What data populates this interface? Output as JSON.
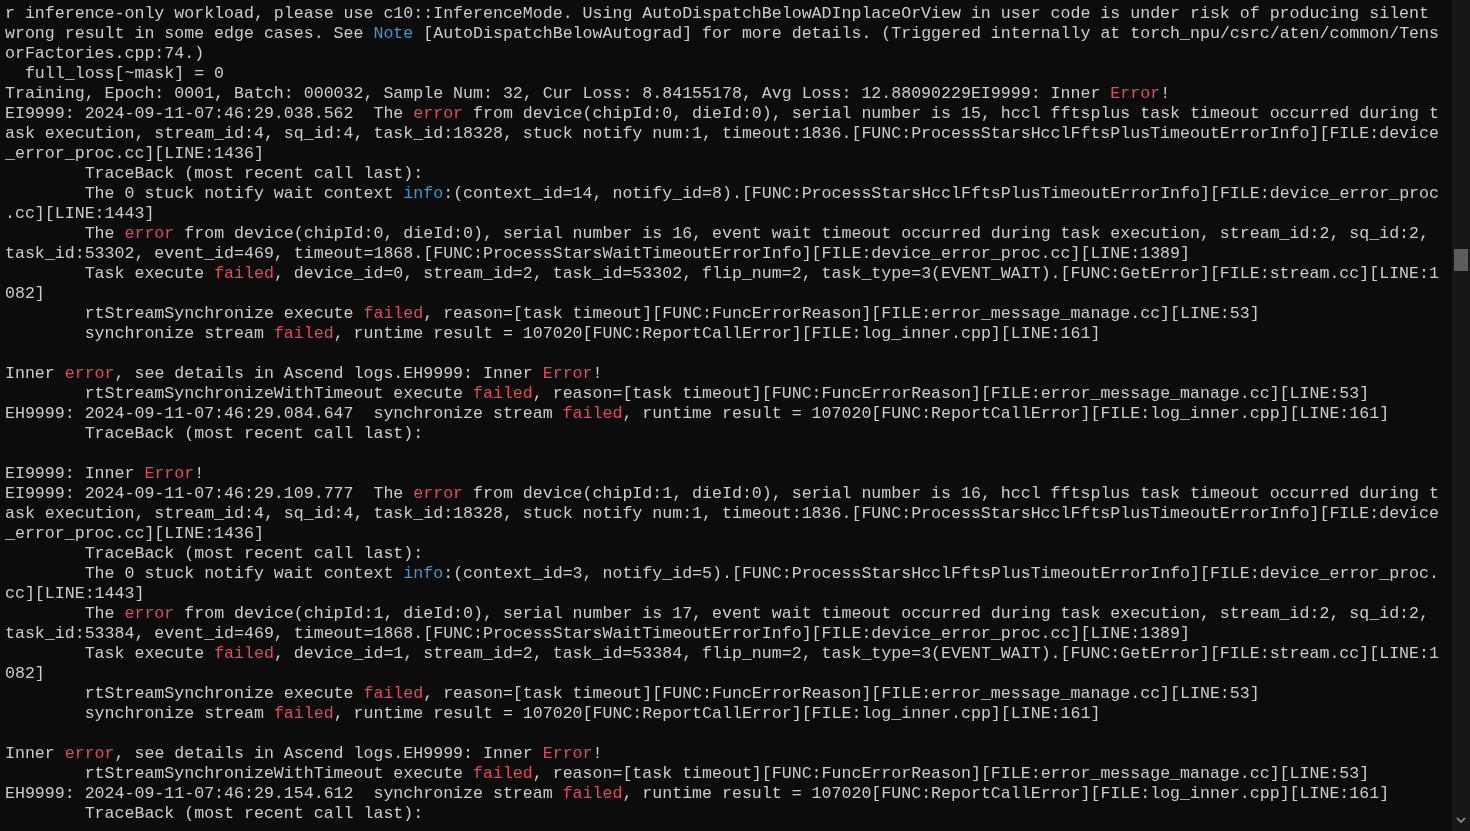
{
  "terminal": {
    "lines": [
      {
        "kind": "text",
        "segments": [
          {
            "text": "r inference-only workload, please use c10::InferenceMode. Using AutoDispatchBelowADInplaceOrView in user code is under risk of producing silent",
            "kind": "plain"
          }
        ]
      },
      {
        "kind": "text",
        "segments": [
          {
            "text": "wrong result in some edge cases. See ",
            "kind": "plain"
          },
          {
            "text": "Note",
            "kind": "info"
          },
          {
            "text": " [AutoDispatchBelowAutograd] for more details. (Triggered internally at torch_npu/csrc/aten/common/Tens",
            "kind": "plain"
          }
        ]
      },
      {
        "kind": "text",
        "segments": [
          {
            "text": "orFactories.cpp:74.)",
            "kind": "plain"
          }
        ]
      },
      {
        "kind": "text",
        "segments": [
          {
            "text": "  full_loss[~mask] = 0",
            "kind": "plain"
          }
        ]
      },
      {
        "kind": "text",
        "segments": [
          {
            "text": "Training, Epoch: 0001, Batch: 000032, Sample Num: 32, Cur Loss: 8.84155178, Avg Loss: 12.88090229EI9999: Inner ",
            "kind": "plain"
          },
          {
            "text": "Error",
            "kind": "error"
          },
          {
            "text": "!",
            "kind": "plain"
          }
        ]
      },
      {
        "kind": "text",
        "segments": [
          {
            "text": "EI9999: 2024-09-11-07:46:29.038.562  The ",
            "kind": "plain"
          },
          {
            "text": "error",
            "kind": "error"
          },
          {
            "text": " from device(chipId:0, dieId:0), serial number is 15, hccl fftsplus task timeout occurred during t",
            "kind": "plain"
          }
        ]
      },
      {
        "kind": "text",
        "segments": [
          {
            "text": "ask execution, stream_id:4, sq_id:4, task_id:18328, stuck notify num:1, timeout:1836.[FUNC:ProcessStarsHcclFftsPlusTimeoutErrorInfo][FILE:device",
            "kind": "plain"
          }
        ]
      },
      {
        "kind": "text",
        "segments": [
          {
            "text": "_error_proc.cc][LINE:1436]",
            "kind": "plain"
          }
        ]
      },
      {
        "kind": "text",
        "segments": [
          {
            "text": "        TraceBack (most recent call last):",
            "kind": "plain"
          }
        ]
      },
      {
        "kind": "text",
        "segments": [
          {
            "text": "        The 0 stuck notify wait context ",
            "kind": "plain"
          },
          {
            "text": "info",
            "kind": "info"
          },
          {
            "text": ":(context_id=14, notify_id=8).[FUNC:ProcessStarsHcclFftsPlusTimeoutErrorInfo][FILE:device_error_proc",
            "kind": "plain"
          }
        ]
      },
      {
        "kind": "text",
        "segments": [
          {
            "text": ".cc][LINE:1443]",
            "kind": "plain"
          }
        ]
      },
      {
        "kind": "text",
        "segments": [
          {
            "text": "        The ",
            "kind": "plain"
          },
          {
            "text": "error",
            "kind": "error"
          },
          {
            "text": " from device(chipId:0, dieId:0), serial number is 16, event wait timeout occurred during task execution, stream_id:2, sq_id:2,",
            "kind": "plain"
          }
        ]
      },
      {
        "kind": "text",
        "segments": [
          {
            "text": "task_id:53302, event_id=469, timeout=1868.[FUNC:ProcessStarsWaitTimeoutErrorInfo][FILE:device_error_proc.cc][LINE:1389]",
            "kind": "plain"
          }
        ]
      },
      {
        "kind": "text",
        "segments": [
          {
            "text": "        Task execute ",
            "kind": "plain"
          },
          {
            "text": "failed",
            "kind": "error"
          },
          {
            "text": ", device_id=0, stream_id=2, task_id=53302, flip_num=2, task_type=3(EVENT_WAIT).[FUNC:GetError][FILE:stream.cc][LINE:1",
            "kind": "plain"
          }
        ]
      },
      {
        "kind": "text",
        "segments": [
          {
            "text": "082]",
            "kind": "plain"
          }
        ]
      },
      {
        "kind": "text",
        "segments": [
          {
            "text": "        rtStreamSynchronize execute ",
            "kind": "plain"
          },
          {
            "text": "failed",
            "kind": "error"
          },
          {
            "text": ", reason=[task timeout][FUNC:FuncErrorReason][FILE:error_message_manage.cc][LINE:53]",
            "kind": "plain"
          }
        ]
      },
      {
        "kind": "text",
        "segments": [
          {
            "text": "        synchronize stream ",
            "kind": "plain"
          },
          {
            "text": "failed",
            "kind": "error"
          },
          {
            "text": ", runtime result = 107020[FUNC:ReportCallError][FILE:log_inner.cpp][LINE:161]",
            "kind": "plain"
          }
        ]
      },
      {
        "kind": "blank"
      },
      {
        "kind": "text",
        "segments": [
          {
            "text": "Inner ",
            "kind": "plain"
          },
          {
            "text": "error",
            "kind": "error"
          },
          {
            "text": ", see details in Ascend logs.EH9999: Inner ",
            "kind": "plain"
          },
          {
            "text": "Error",
            "kind": "error"
          },
          {
            "text": "!",
            "kind": "plain"
          }
        ]
      },
      {
        "kind": "text",
        "segments": [
          {
            "text": "        rtStreamSynchronizeWithTimeout execute ",
            "kind": "plain"
          },
          {
            "text": "failed",
            "kind": "error"
          },
          {
            "text": ", reason=[task timeout][FUNC:FuncErrorReason][FILE:error_message_manage.cc][LINE:53]",
            "kind": "plain"
          }
        ]
      },
      {
        "kind": "text",
        "segments": [
          {
            "text": "EH9999: 2024-09-11-07:46:29.084.647  synchronize stream ",
            "kind": "plain"
          },
          {
            "text": "failed",
            "kind": "error"
          },
          {
            "text": ", runtime result = 107020[FUNC:ReportCallError][FILE:log_inner.cpp][LINE:161]",
            "kind": "plain"
          }
        ]
      },
      {
        "kind": "text",
        "segments": [
          {
            "text": "        TraceBack (most recent call last):",
            "kind": "plain"
          }
        ]
      },
      {
        "kind": "blank"
      },
      {
        "kind": "text",
        "segments": [
          {
            "text": "EI9999: Inner ",
            "kind": "plain"
          },
          {
            "text": "Error",
            "kind": "error"
          },
          {
            "text": "!",
            "kind": "plain"
          }
        ]
      },
      {
        "kind": "text",
        "segments": [
          {
            "text": "EI9999: 2024-09-11-07:46:29.109.777  The ",
            "kind": "plain"
          },
          {
            "text": "error",
            "kind": "error"
          },
          {
            "text": " from device(chipId:1, dieId:0), serial number is 16, hccl fftsplus task timeout occurred during t",
            "kind": "plain"
          }
        ]
      },
      {
        "kind": "text",
        "segments": [
          {
            "text": "ask execution, stream_id:4, sq_id:4, task_id:18328, stuck notify num:1, timeout:1836.[FUNC:ProcessStarsHcclFftsPlusTimeoutErrorInfo][FILE:device",
            "kind": "plain"
          }
        ]
      },
      {
        "kind": "text",
        "segments": [
          {
            "text": "_error_proc.cc][LINE:1436]",
            "kind": "plain"
          }
        ]
      },
      {
        "kind": "text",
        "segments": [
          {
            "text": "        TraceBack (most recent call last):",
            "kind": "plain"
          }
        ]
      },
      {
        "kind": "text",
        "segments": [
          {
            "text": "        The 0 stuck notify wait context ",
            "kind": "plain"
          },
          {
            "text": "info",
            "kind": "info"
          },
          {
            "text": ":(context_id=3, notify_id=5).[FUNC:ProcessStarsHcclFftsPlusTimeoutErrorInfo][FILE:device_error_proc.",
            "kind": "plain"
          }
        ]
      },
      {
        "kind": "text",
        "segments": [
          {
            "text": "cc][LINE:1443]",
            "kind": "plain"
          }
        ]
      },
      {
        "kind": "text",
        "segments": [
          {
            "text": "        The ",
            "kind": "plain"
          },
          {
            "text": "error",
            "kind": "error"
          },
          {
            "text": " from device(chipId:1, dieId:0), serial number is 17, event wait timeout occurred during task execution, stream_id:2, sq_id:2,",
            "kind": "plain"
          }
        ]
      },
      {
        "kind": "text",
        "segments": [
          {
            "text": "task_id:53384, event_id=469, timeout=1868.[FUNC:ProcessStarsWaitTimeoutErrorInfo][FILE:device_error_proc.cc][LINE:1389]",
            "kind": "plain"
          }
        ]
      },
      {
        "kind": "text",
        "segments": [
          {
            "text": "        Task execute ",
            "kind": "plain"
          },
          {
            "text": "failed",
            "kind": "error"
          },
          {
            "text": ", device_id=1, stream_id=2, task_id=53384, flip_num=2, task_type=3(EVENT_WAIT).[FUNC:GetError][FILE:stream.cc][LINE:1",
            "kind": "plain"
          }
        ]
      },
      {
        "kind": "text",
        "segments": [
          {
            "text": "082]",
            "kind": "plain"
          }
        ]
      },
      {
        "kind": "text",
        "segments": [
          {
            "text": "        rtStreamSynchronize execute ",
            "kind": "plain"
          },
          {
            "text": "failed",
            "kind": "error"
          },
          {
            "text": ", reason=[task timeout][FUNC:FuncErrorReason][FILE:error_message_manage.cc][LINE:53]",
            "kind": "plain"
          }
        ]
      },
      {
        "kind": "text",
        "segments": [
          {
            "text": "        synchronize stream ",
            "kind": "plain"
          },
          {
            "text": "failed",
            "kind": "error"
          },
          {
            "text": ", runtime result = 107020[FUNC:ReportCallError][FILE:log_inner.cpp][LINE:161]",
            "kind": "plain"
          }
        ]
      },
      {
        "kind": "blank"
      },
      {
        "kind": "text",
        "segments": [
          {
            "text": "Inner ",
            "kind": "plain"
          },
          {
            "text": "error",
            "kind": "error"
          },
          {
            "text": ", see details in Ascend logs.EH9999: Inner ",
            "kind": "plain"
          },
          {
            "text": "Error",
            "kind": "error"
          },
          {
            "text": "!",
            "kind": "plain"
          }
        ]
      },
      {
        "kind": "text",
        "segments": [
          {
            "text": "        rtStreamSynchronizeWithTimeout execute ",
            "kind": "plain"
          },
          {
            "text": "failed",
            "kind": "error"
          },
          {
            "text": ", reason=[task timeout][FUNC:FuncErrorReason][FILE:error_message_manage.cc][LINE:53]",
            "kind": "plain"
          }
        ]
      },
      {
        "kind": "text",
        "segments": [
          {
            "text": "EH9999: 2024-09-11-07:46:29.154.612  synchronize stream ",
            "kind": "plain"
          },
          {
            "text": "failed",
            "kind": "error"
          },
          {
            "text": ", runtime result = 107020[FUNC:ReportCallError][FILE:log_inner.cpp][LINE:161]",
            "kind": "plain"
          }
        ]
      },
      {
        "kind": "text",
        "segments": [
          {
            "text": "        TraceBack (most recent call last):",
            "kind": "plain"
          }
        ]
      }
    ]
  }
}
